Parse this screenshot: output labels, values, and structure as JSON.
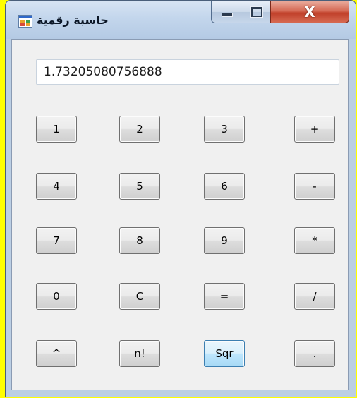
{
  "window": {
    "title": "حاسبة رقمية",
    "close_glyph": "X"
  },
  "display": {
    "value": "1.73205080756888"
  },
  "keypad": {
    "rows": [
      [
        "1",
        "2",
        "3",
        "+"
      ],
      [
        "4",
        "5",
        "6",
        "-"
      ],
      [
        "7",
        "8",
        "9",
        "*"
      ],
      [
        "0",
        "C",
        "=",
        "/"
      ],
      [
        "^",
        "n!",
        "Sqr",
        "."
      ]
    ]
  },
  "colors": {
    "background": "#FFFF00",
    "titlebar": "#c3d6ec",
    "close_button": "#c0402a",
    "client_area": "#f0f0f0",
    "hot_button": "#bee6fd"
  },
  "icons": {
    "app": "windows-form-icon",
    "minimize": "minimize-icon",
    "maximize": "maximize-icon",
    "close": "close-icon"
  }
}
